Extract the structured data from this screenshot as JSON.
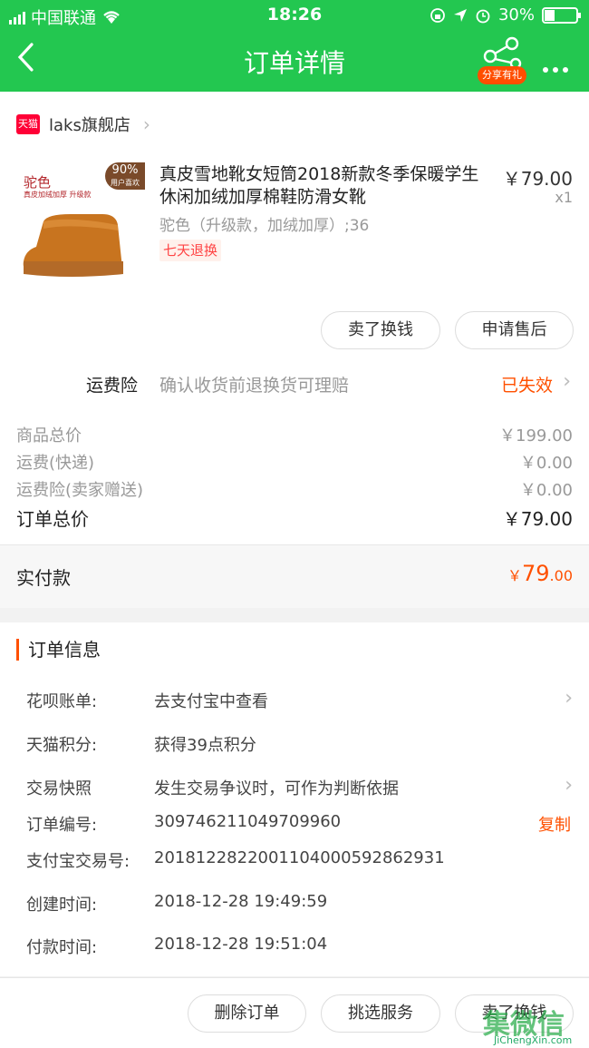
{
  "status_bar": {
    "carrier": "中国联通",
    "time": "18:26",
    "battery": "30%"
  },
  "nav": {
    "back_glyph": "‹",
    "title": "订单详情",
    "share_badge": "分享有礼",
    "more_glyph": "•••"
  },
  "shop": {
    "platform_badge": "天猫",
    "name": "laks旗舰店"
  },
  "product": {
    "image_badge_top": "90%",
    "image_badge_sub": "用户喜欢",
    "image_label": "驼色",
    "image_sublabel": "真皮加绒加厚 升级款",
    "title": "真皮雪地靴女短筒2018新款冬季保暖学生休闲加绒加厚棉鞋防滑女靴",
    "sku": "驼色（升级款，加绒加厚）;36",
    "tag": "七天退换",
    "price": "￥79.00",
    "qty": "x1"
  },
  "actions": {
    "sell_label": "卖了换钱",
    "aftersale_label": "申请售后"
  },
  "insurance": {
    "label": "运费险",
    "desc": "确认收货前退换货可理赔",
    "status": "已失效"
  },
  "fees": [
    {
      "label": "商品总价",
      "value": "￥199.00"
    },
    {
      "label": "运费(快递)",
      "value": "￥0.00"
    },
    {
      "label": "运费险(卖家赠送)",
      "value": "￥0.00"
    },
    {
      "label": "订单总价",
      "value": "￥79.00"
    }
  ],
  "paid": {
    "label": "实付款",
    "currency": "￥",
    "integer": "79",
    "decimal": ".00"
  },
  "order_info": {
    "title": "订单信息",
    "rows": [
      {
        "key": "花呗账单:",
        "value": "去支付宝中查看"
      },
      {
        "key": "天猫积分:",
        "value": "获得39点积分"
      },
      {
        "key": "交易快照",
        "value": "发生交易争议时，可作为判断依据"
      },
      {
        "key": "订单编号:",
        "value": "309746211049709960",
        "action": "复制"
      },
      {
        "key": "支付宝交易号:",
        "value": "2018122822001104000592862931"
      },
      {
        "key": "创建时间:",
        "value": "2018-12-28 19:49:59"
      },
      {
        "key": "付款时间:",
        "value": "2018-12-28 19:51:04"
      }
    ]
  },
  "bottom_bar": {
    "delete_label": "删除订单",
    "service_label": "挑选服务",
    "sell_label": "卖了换钱"
  },
  "watermark": {
    "text": "集微信",
    "sub": "JiChengXin.com"
  },
  "colors": {
    "header_green": "#23c750",
    "accent_orange": "#ff5000",
    "tmall_red": "#ff0036"
  }
}
